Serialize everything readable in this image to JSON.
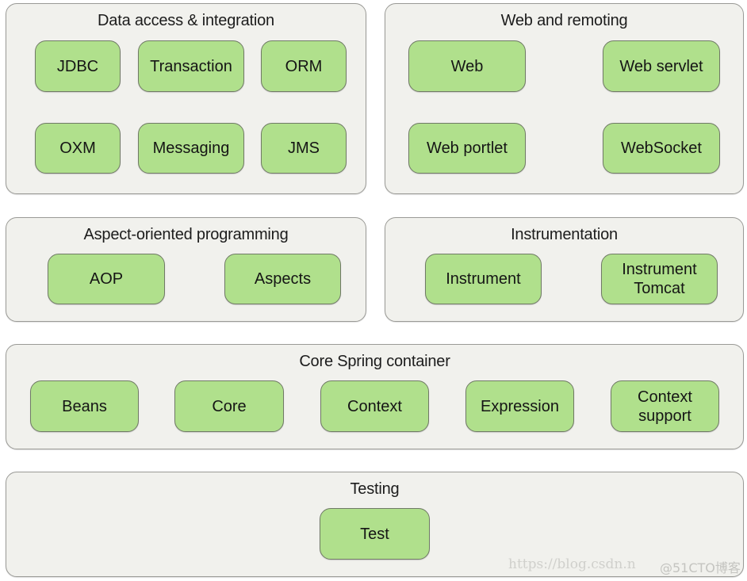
{
  "diagram": {
    "panels": [
      {
        "id": "data-access",
        "title": "Data access & integration",
        "modules": [
          "JDBC",
          "Transaction",
          "ORM",
          "OXM",
          "Messaging",
          "JMS"
        ]
      },
      {
        "id": "web-remoting",
        "title": "Web and remoting",
        "modules": [
          "Web",
          "Web servlet",
          "Web portlet",
          "WebSocket"
        ]
      },
      {
        "id": "aop",
        "title": "Aspect-oriented programming",
        "modules": [
          "AOP",
          "Aspects"
        ]
      },
      {
        "id": "instrumentation",
        "title": "Instrumentation",
        "modules": [
          "Instrument",
          "Instrument\nTomcat"
        ]
      },
      {
        "id": "core-container",
        "title": "Core Spring container",
        "modules": [
          "Beans",
          "Core",
          "Context",
          "Expression",
          "Context\nsupport"
        ]
      },
      {
        "id": "testing",
        "title": "Testing",
        "modules": [
          "Test"
        ]
      }
    ],
    "colors": {
      "panel_fill": "#f1f1ed",
      "panel_border": "#9a9a96",
      "module_fill": "#b0e08c",
      "module_border": "#707a66"
    }
  },
  "watermark": {
    "url_text": "https://blog.csdn.n",
    "brand_text": "@51CTO博客"
  }
}
